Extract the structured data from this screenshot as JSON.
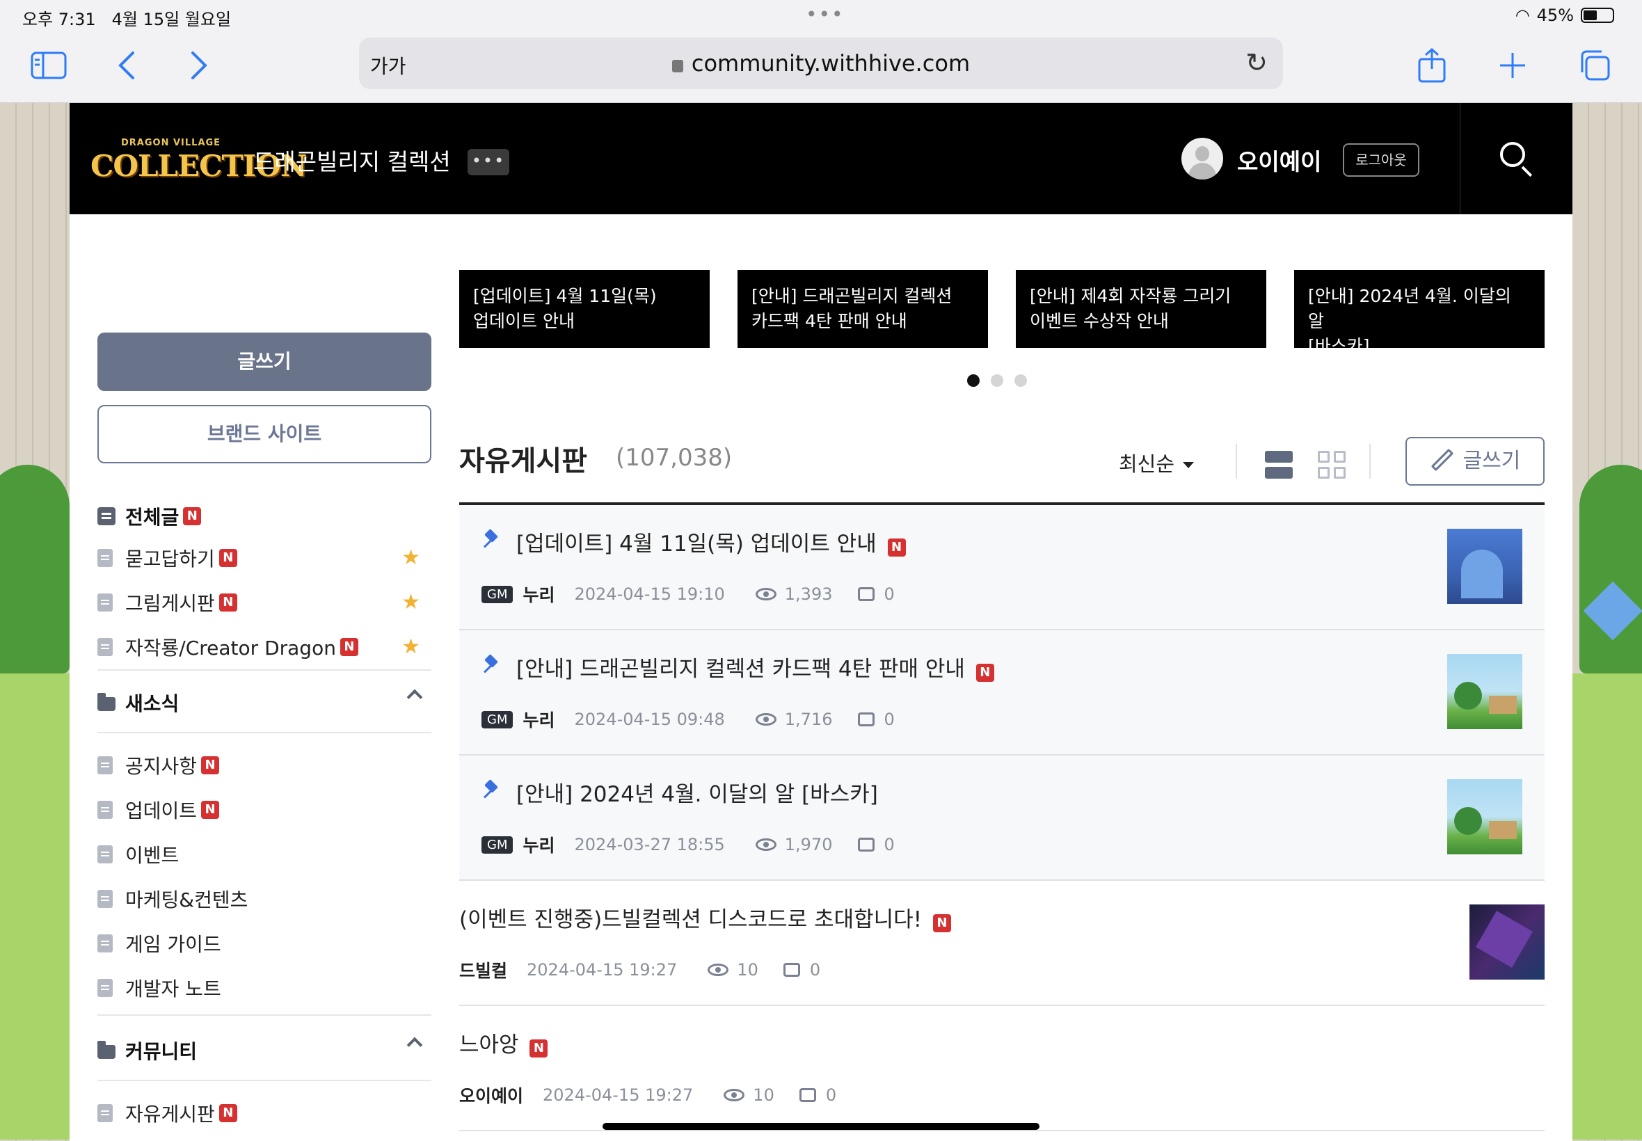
{
  "status": {
    "time": "오후 7:31",
    "date": "4월 15일 월요일",
    "dots": "•••",
    "battery": "45%",
    "battery_level": 0.45
  },
  "browser": {
    "text_size": "가가",
    "url": "community.withhive.com"
  },
  "header": {
    "logo_top": "DRAGON VILLAGE",
    "logo_main": "COLLECTION",
    "site_title": "드래곤빌리지 컬렉션",
    "more": "•••",
    "username": "오이예이",
    "logout": "로그아웃"
  },
  "sidebar": {
    "write": "글쓰기",
    "brand": "브랜드 사이트",
    "all_posts": "전체글",
    "favorites": [
      {
        "label": "묻고답하기",
        "new": "N"
      },
      {
        "label": "그림게시판",
        "new": "N"
      },
      {
        "label": "자작룡/Creator Dragon",
        "new": "N"
      }
    ],
    "news": {
      "title": "새소식",
      "items": [
        {
          "label": "공지사항",
          "new": "N"
        },
        {
          "label": "업데이트",
          "new": "N"
        },
        {
          "label": "이벤트",
          "new": ""
        },
        {
          "label": "마케팅&컨텐츠",
          "new": ""
        },
        {
          "label": "게임 가이드",
          "new": ""
        },
        {
          "label": "개발자 노트",
          "new": ""
        }
      ]
    },
    "community": {
      "title": "커뮤니티",
      "items": [
        {
          "label": "자유게시판",
          "new": "N"
        }
      ]
    },
    "new_badge": "N",
    "star": "★"
  },
  "carousel": {
    "cards": [
      {
        "line1": "[업데이트] 4월 11일(목)",
        "line2": "업데이트 안내"
      },
      {
        "line1": "[안내] 드래곤빌리지 컬렉션",
        "line2": "카드팩 4탄 판매 안내"
      },
      {
        "line1": "[안내] 제4회 자작룡 그리기",
        "line2": "이벤트 수상작 안내"
      },
      {
        "line1": "[안내] 2024년 4월. 이달의 알",
        "line2": "[바스카]"
      }
    ]
  },
  "board": {
    "title": "자유게시판",
    "count": "(107,038)",
    "sort": "최신순",
    "write": "글쓰기",
    "posts": [
      {
        "title": "[업데이트] 4월 11일(목) 업데이트 안내",
        "new": "N",
        "gm": "GM",
        "author": "누리",
        "date": "2024-04-15 19:10",
        "views": "1,393",
        "comments": "0"
      },
      {
        "title": "[안내] 드래곤빌리지 컬렉션 카드팩 4탄 판매 안내",
        "new": "N",
        "gm": "GM",
        "author": "누리",
        "date": "2024-04-15 09:48",
        "views": "1,716",
        "comments": "0"
      },
      {
        "title": "[안내] 2024년 4월. 이달의 알 [바스카]",
        "new": "",
        "gm": "GM",
        "author": "누리",
        "date": "2024-03-27 18:55",
        "views": "1,970",
        "comments": "0"
      },
      {
        "title": "(이벤트 진행중)드빌컬렉션 디스코드로 초대합니다!",
        "new": "N",
        "author": "드빌컬",
        "date": "2024-04-15 19:27",
        "views": "10",
        "comments": "0"
      },
      {
        "title": "느아앙",
        "new": "N",
        "author": "오이예이",
        "date": "2024-04-15 19:27",
        "views": "10",
        "comments": "0"
      }
    ]
  }
}
